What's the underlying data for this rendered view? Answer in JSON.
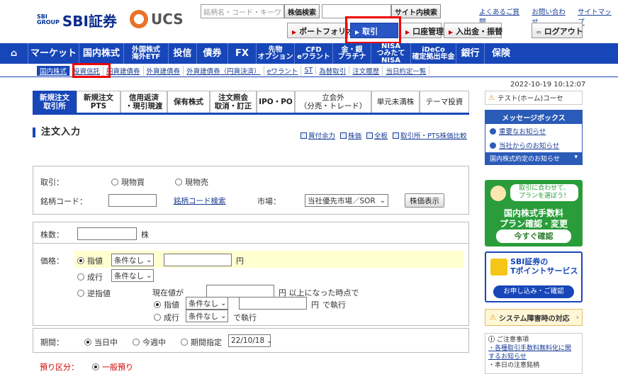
{
  "header": {
    "logo_sbi_mark": "SBI\nGROUP",
    "logo_sbi": "SBI証券",
    "logo_ucs": "UCS",
    "search_placeholder": "銘柄名・コード・キーワ",
    "stock_search_btn": "株価検索",
    "site_search_btn": "サイト内検索",
    "links": [
      "よくあるご質問",
      "お問い合わせ",
      "サイトマップ"
    ],
    "nav": [
      {
        "label": "ポートフォリオ",
        "active": false
      },
      {
        "label": "取引",
        "active": true
      },
      {
        "label": "口座管理",
        "active": false
      },
      {
        "label": "入出金・振替",
        "active": false
      }
    ],
    "logout": "ログアウト"
  },
  "mainnav": [
    {
      "label": "⌂"
    },
    {
      "label": "マーケット"
    },
    {
      "label": "国内株式"
    },
    {
      "label": "外国株式",
      "sub": "海外ETF"
    },
    {
      "label": "投信"
    },
    {
      "label": "債券"
    },
    {
      "label": "FX"
    },
    {
      "label": "先物",
      "sub": "オプション"
    },
    {
      "label": "CFD",
      "sub": "eワラント"
    },
    {
      "label": "金・銀",
      "sub": "プラチナ"
    },
    {
      "label": "NISA",
      "sub": "つみたてNISA"
    },
    {
      "label": "iDeCo",
      "sub": "確定拠出年金"
    },
    {
      "label": "銀行"
    },
    {
      "label": "保険"
    }
  ],
  "subnav": [
    "国内株式",
    "投資信託",
    "円貨建債券",
    "外貨建債券",
    "外貨建債券（円貨決済）",
    "eワラント",
    "ST",
    "為替取引",
    "注文履歴",
    "当日約定一覧"
  ],
  "datetime": "2022-10-19 10:12:07",
  "tabs": [
    {
      "l1": "新規注文",
      "l2": "取引所",
      "active": true
    },
    {
      "l1": "新規注文",
      "l2": "PTS"
    },
    {
      "l1": "信用返済",
      "l2": "・現引現渡"
    },
    {
      "l1": "保有株式",
      "l2": ""
    },
    {
      "l1": "注文照会",
      "l2": "取消・訂正"
    },
    {
      "l1": "IPO・PO",
      "l2": ""
    },
    {
      "l1": "立会外",
      "l2": "（分売・トレード）"
    },
    {
      "l1": "単元未満株",
      "l2": ""
    },
    {
      "l1": "テーマ投資",
      "l2": ""
    }
  ],
  "section_title": "注文入力",
  "section_links": [
    "買付余力",
    "株価",
    "全板",
    "取引所・PTS株価比較"
  ],
  "form": {
    "trade_label": "取引",
    "buy": "現物買",
    "sell": "現物売",
    "code_label": "銘柄コード",
    "code_search": "銘柄コード検索",
    "market_label": "市場",
    "market_value": "当社優先市場／SOR",
    "price_btn": "株価表示",
    "qty_label": "株数",
    "qty_unit": "株",
    "price_label": "価格",
    "limit": "指値",
    "cond_none": "条件なし",
    "yen": "円",
    "market": "成行",
    "stop": "逆指値",
    "now_price": "現在値が",
    "above": "円 以上になった時点で",
    "exec_suffix": "で執行",
    "period_label": "期間",
    "today": "当日中",
    "this_week": "今週中",
    "period_specify": "期間指定",
    "date_value": "22/10/18",
    "deposit_label": "預り区分",
    "general": "一般預り"
  },
  "right": {
    "test_label": "テスト(ホーム)コーセ",
    "msgbox": "メッセージボックス",
    "msg_lines": [
      "重要なお知らせ",
      "当社からのお知らせ"
    ],
    "msg_footer": "国内株式約定のお知らせ",
    "green_line1": "取引に合わせて、",
    "green_line2": "プランを選ぼう！",
    "green_title": "国内株式手数料",
    "green_sub": "プラン確認・変更",
    "green_btn": "今すぐ確認",
    "blue_line1": "SBI証券の",
    "blue_line2": "Tポイントサービス",
    "blue_btn": "お申し込み・ご確認",
    "warn": "システム障害時の対応",
    "notice_title": "ご注意事項",
    "notice_lines": [
      "・各種取引手数料無料化に関",
      "するお知らせ",
      "・本日の注意銘柄"
    ]
  }
}
